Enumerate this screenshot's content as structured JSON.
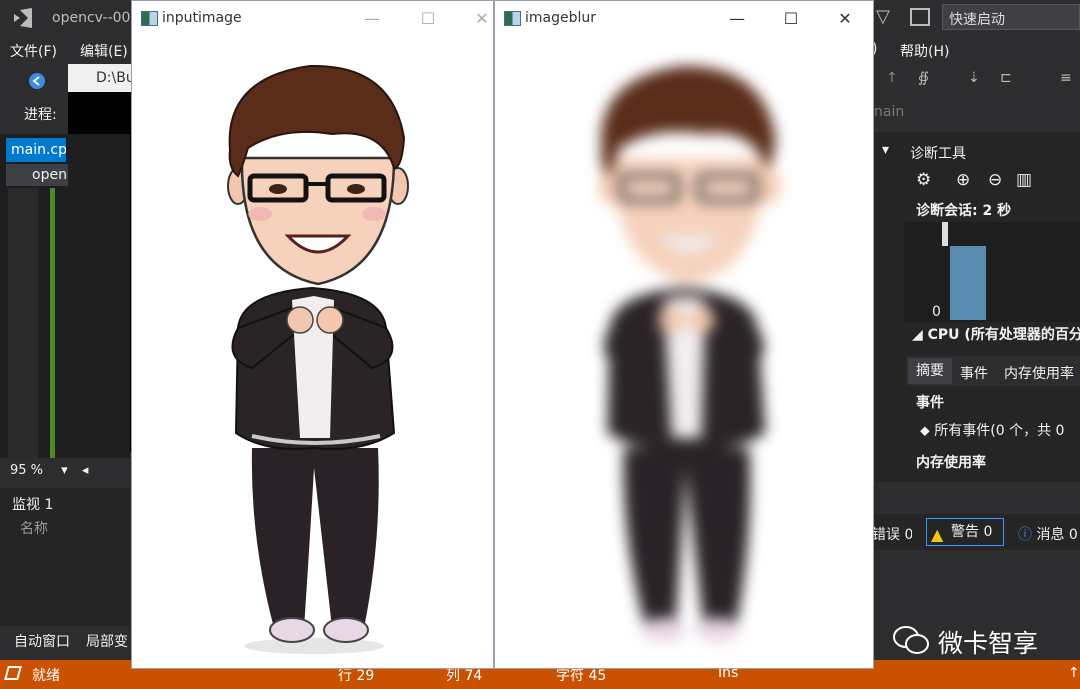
{
  "vs": {
    "title": "opencv--00",
    "quick_launch": "快速启动",
    "menu_file": "文件(F)",
    "menu_edit": "编辑(E)",
    "menu_help": "帮助(H)",
    "process_label": "进程:",
    "tab_main": "main.cp",
    "tab_open": "open",
    "debug_window_path": "D:\\Bu",
    "zoom": "95 %",
    "thread_fragment": "nain"
  },
  "watch": {
    "title": "监视 1",
    "name_col": "名称"
  },
  "bottom_tabs": {
    "auto_window": "自动窗口",
    "local_vars": "局部变"
  },
  "diagnostics": {
    "title": "诊断工具",
    "session": "诊断会话: 2 秒",
    "axis_zero": "0",
    "cpu_label": "CPU (所有处理器的百分",
    "tab_summary": "摘要",
    "tab_events": "事件",
    "tab_memory": "内存使用率",
    "events_header": "事件",
    "all_events": "所有事件(0 个，共 0",
    "memory_header": "内存使用率"
  },
  "error_list": {
    "errors": "错误 0",
    "warnings": "警告 0",
    "messages": "消息 0"
  },
  "status_bar": {
    "ready": "就绪",
    "line": "行 29",
    "col": "列 74",
    "char": "字符 45",
    "ins": "Ins"
  },
  "input_window": {
    "title": "inputimage"
  },
  "blur_window": {
    "title": "imageblur"
  },
  "watermark": "微卡智享",
  "colors": {
    "vs_bg": "#2d2d30",
    "status_orange": "#ca5100",
    "accent_blue": "#007acc"
  }
}
